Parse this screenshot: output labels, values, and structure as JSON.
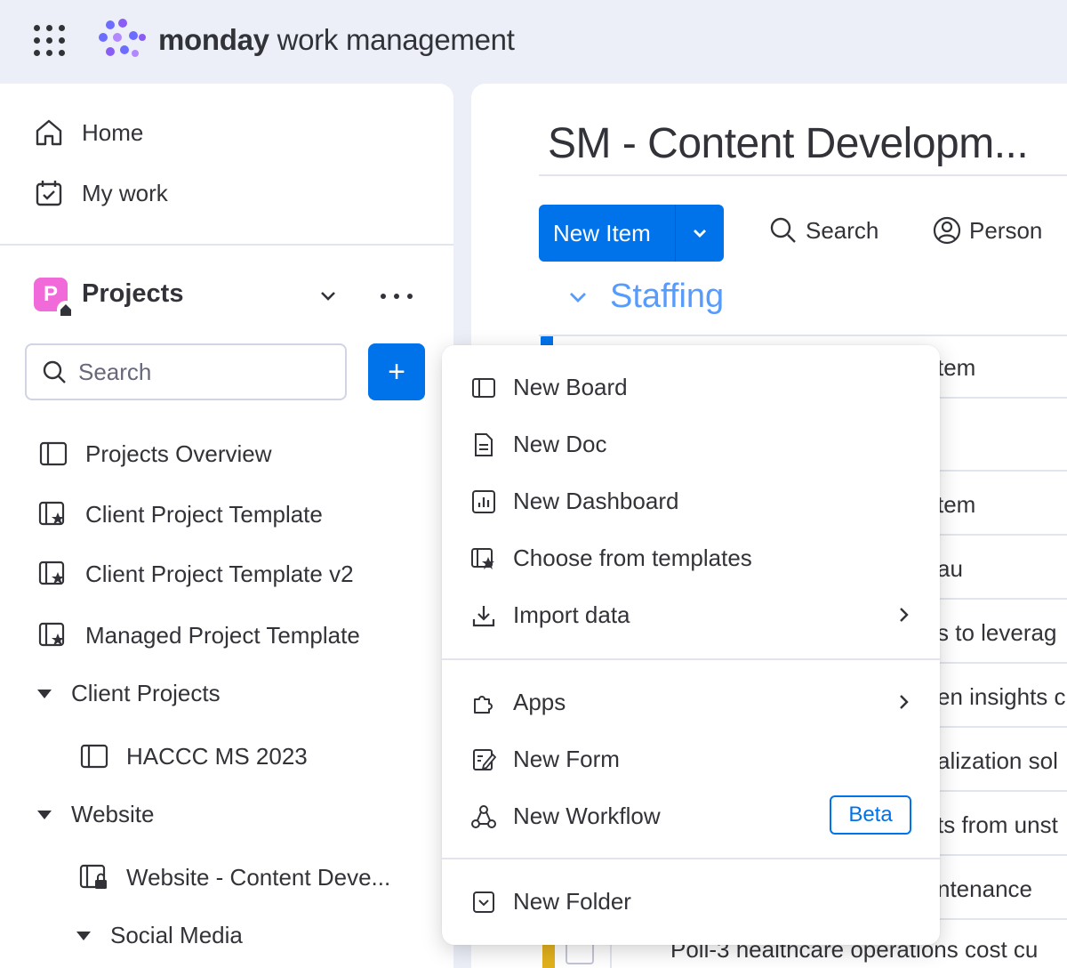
{
  "app": {
    "brand_bold": "monday",
    "brand_rest": " work management"
  },
  "sidebar": {
    "nav": [
      {
        "label": "Home",
        "icon": "home-icon"
      },
      {
        "label": "My work",
        "icon": "calendar-check-icon"
      }
    ],
    "workspace": {
      "badge": "P",
      "title": "Projects"
    },
    "search": {
      "placeholder": "Search"
    },
    "add_label": "+",
    "items": [
      {
        "label": "Projects Overview",
        "icon": "board-icon"
      },
      {
        "label": "Client Project Template",
        "icon": "template-icon"
      },
      {
        "label": "Client Project Template v2",
        "icon": "template-icon"
      },
      {
        "label": "Managed Project Template",
        "icon": "template-icon"
      },
      {
        "label": "Client Projects",
        "icon": "caret-down-icon"
      },
      {
        "label": "HACCC MS 2023",
        "icon": "board-icon"
      },
      {
        "label": "Website",
        "icon": "caret-down-icon"
      },
      {
        "label": "Website - Content Deve...",
        "icon": "private-board-icon"
      },
      {
        "label": "Social Media",
        "icon": "caret-down-icon"
      }
    ]
  },
  "board": {
    "title": "SM - Content Developm...",
    "new_item": "New Item",
    "search": "Search",
    "person": "Person",
    "group": "Staffing",
    "rows": [
      "tem",
      "tem",
      "au",
      "s to leverag",
      "en insights c",
      "alization sol",
      "ts from unst",
      "ntenance"
    ],
    "bottom_row": "Poll-3 healthcare operations cost cu"
  },
  "menu": {
    "items": [
      {
        "label": "New Board",
        "icon": "board-icon"
      },
      {
        "label": "New Doc",
        "icon": "doc-icon"
      },
      {
        "label": "New Dashboard",
        "icon": "dashboard-icon"
      },
      {
        "label": "Choose from templates",
        "icon": "template-icon"
      },
      {
        "label": "Import data",
        "icon": "download-icon"
      },
      {
        "label": "Apps",
        "icon": "puzzle-icon"
      },
      {
        "label": "New Form",
        "icon": "form-icon"
      },
      {
        "label": "New Workflow",
        "icon": "workflow-icon"
      },
      {
        "label": "New Folder",
        "icon": "folder-icon"
      }
    ],
    "beta_label": "Beta"
  },
  "colors": {
    "primary": "#0073ea",
    "group": "#579bfc",
    "workspace_badge": "#f06bd9",
    "bottom_marker": "#e2b11d"
  }
}
